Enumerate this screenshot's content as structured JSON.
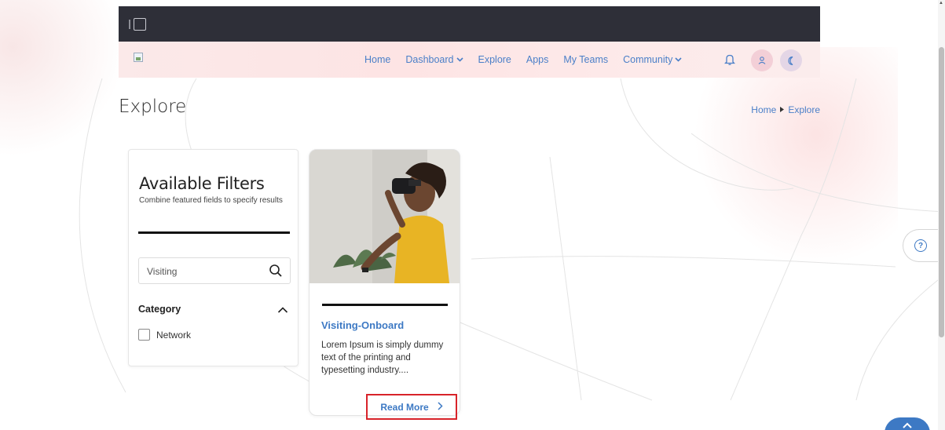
{
  "navbar": {
    "items": [
      {
        "label": "Home"
      },
      {
        "label": "Dashboard",
        "dropdown": true
      },
      {
        "label": "Explore"
      },
      {
        "label": "Apps"
      },
      {
        "label": "My Teams"
      },
      {
        "label": "Community",
        "dropdown": true
      }
    ],
    "icons": [
      "bell-icon",
      "user-icon",
      "moon-icon"
    ]
  },
  "page": {
    "title": "Explore",
    "breadcrumb": [
      "Home",
      "Explore"
    ]
  },
  "filters": {
    "title": "Available Filters",
    "subtitle": "Combine featured fields to specify results",
    "search": {
      "value": "Visiting"
    },
    "category": {
      "label": "Category",
      "options": [
        {
          "label": "Network",
          "checked": false
        }
      ]
    }
  },
  "card": {
    "title": "Visiting-Onboard",
    "description": "Lorem Ipsum is simply dummy text of the printing and typesetting industry....",
    "action_label": "Read More"
  },
  "colors": {
    "accent": "#3d79c4",
    "highlight_border": "#d8232a",
    "topbar": "#2e2f38"
  }
}
